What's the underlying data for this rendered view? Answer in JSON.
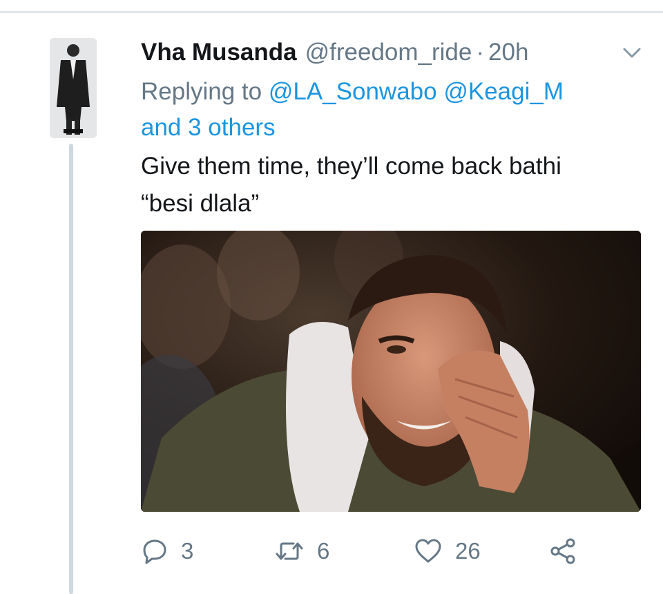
{
  "tweet": {
    "display_name": "Vha Musanda",
    "handle": "@freedom_ride",
    "separator": "·",
    "time": "20h",
    "replying_prefix": "Replying to",
    "mentions": [
      "@LA_Sonwabo",
      "@Keagi_M"
    ],
    "others_text": "and 3 others",
    "text_lines": [
      "Give them time, they’ll come back bathi",
      "“besi dlala”"
    ]
  },
  "actions": {
    "replies": "3",
    "retweets": "6",
    "likes": "26"
  },
  "icons": {
    "menu": "chevron-down-icon",
    "reply": "reply-icon",
    "retweet": "retweet-icon",
    "like": "heart-icon",
    "share": "share-icon"
  },
  "colors": {
    "link": "#1b95e0",
    "muted": "#657786",
    "text": "#14171a",
    "thread_line": "#cdd8e1"
  }
}
